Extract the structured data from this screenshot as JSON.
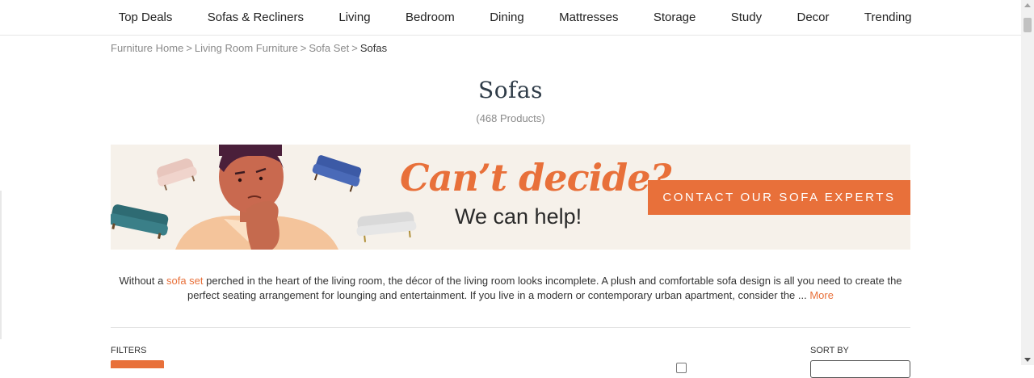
{
  "nav": {
    "items": [
      "Top Deals",
      "Sofas & Recliners",
      "Living",
      "Bedroom",
      "Dining",
      "Mattresses",
      "Storage",
      "Study",
      "Decor",
      "Trending"
    ]
  },
  "breadcrumb": {
    "items": [
      "Furniture Home",
      "Living Room Furniture",
      "Sofa Set"
    ],
    "current": "Sofas",
    "separator": ">"
  },
  "page": {
    "title": "Sofas",
    "count": "(468 Products)"
  },
  "banner": {
    "headline": "Can’t decide?",
    "subline": "We can help!",
    "cta": "CONTACT OUR SOFA EXPERTS"
  },
  "description": {
    "before_link": "Without a ",
    "link": "sofa set",
    "after_link": " perched in the heart of the living room, the décor of the living room looks incomplete. A plush and comfortable sofa design is all you need to create the perfect seating arrangement for lounging and entertainment. If you live in a modern or contemporary urban apartment, consider the ... ",
    "more": "More"
  },
  "filters": {
    "label": "FILTERS"
  },
  "sort": {
    "label": "SORT BY"
  },
  "colors": {
    "accent": "#e8703a",
    "title": "#2f3c48"
  }
}
